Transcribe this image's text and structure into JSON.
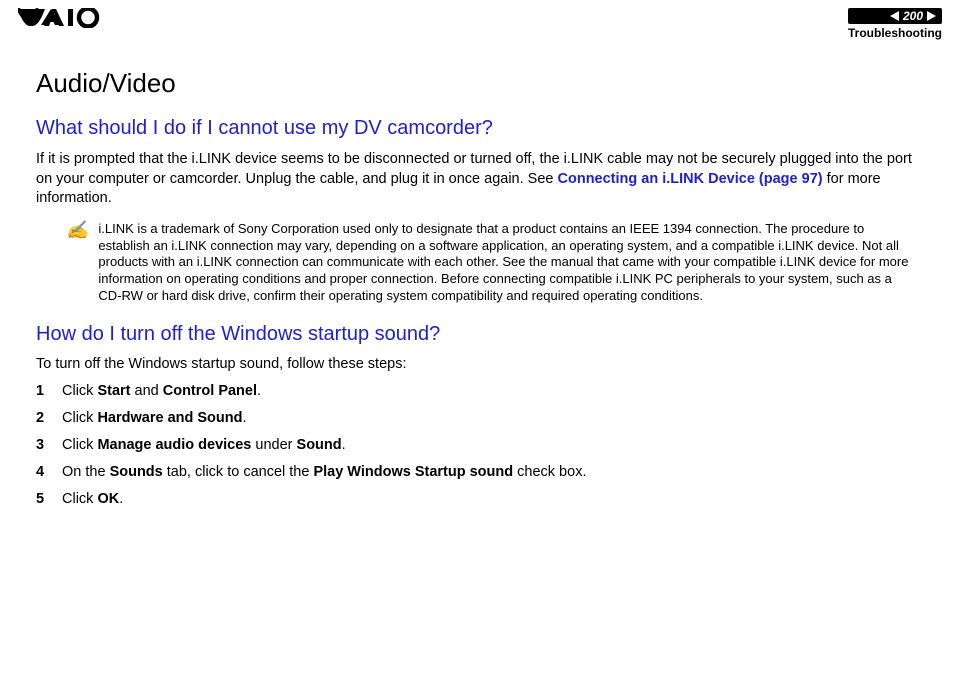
{
  "header": {
    "page_number": "200",
    "section": "Troubleshooting"
  },
  "title": "Audio/Video",
  "q1": {
    "heading": "What should I do if I cannot use my DV camcorder?",
    "para_a": "If it is prompted that the i.LINK device seems to be disconnected or turned off, the i.LINK cable may not be securely plugged into the port on your computer or camcorder. Unplug the cable, and plug it in once again. See ",
    "para_link": "Connecting an i.LINK Device (page 97)",
    "para_b": " for more information.",
    "note": "i.LINK is a trademark of Sony Corporation used only to designate that a product contains an IEEE 1394 connection. The procedure to establish an i.LINK connection may vary, depending on a software application, an operating system, and a compatible i.LINK device. Not all products with an i.LINK connection can communicate with each other. See the manual that came with your compatible i.LINK device for more information on operating conditions and proper connection. Before connecting compatible i.LINK PC peripherals to your system, such as a CD-RW or hard disk drive, confirm their operating system compatibility and required operating conditions."
  },
  "q2": {
    "heading": "How do I turn off the Windows startup sound?",
    "intro": "To turn off the Windows startup sound, follow these steps:",
    "steps": {
      "s1_a": "Click ",
      "s1_b": "Start",
      "s1_c": " and ",
      "s1_d": "Control Panel",
      "s1_e": ".",
      "s2_a": "Click ",
      "s2_b": "Hardware and Sound",
      "s2_c": ".",
      "s3_a": "Click ",
      "s3_b": "Manage audio devices",
      "s3_c": " under ",
      "s3_d": "Sound",
      "s3_e": ".",
      "s4_a": "On the ",
      "s4_b": "Sounds",
      "s4_c": " tab, click to cancel the ",
      "s4_d": "Play Windows Startup sound",
      "s4_e": " check box.",
      "s5_a": "Click ",
      "s5_b": "OK",
      "s5_c": "."
    }
  }
}
